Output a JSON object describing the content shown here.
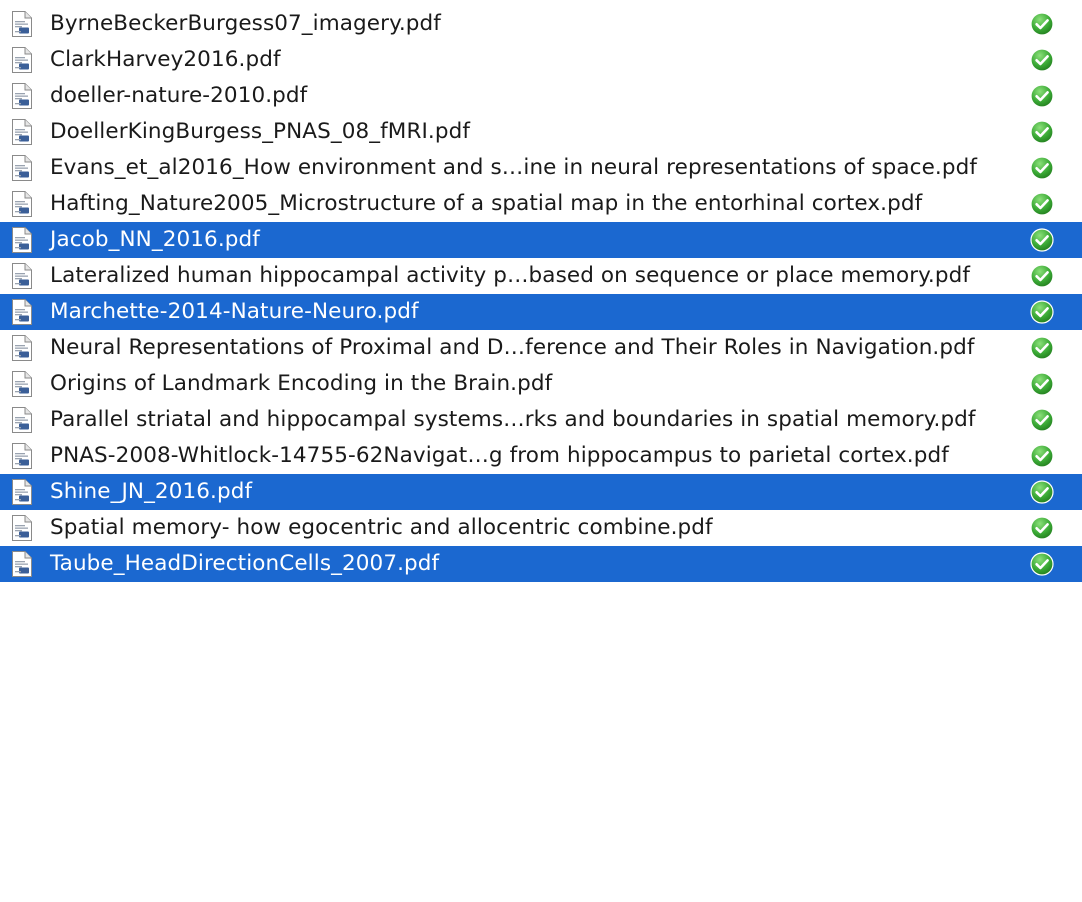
{
  "files": [
    {
      "name": "ByrneBeckerBurgess07_imagery.pdf",
      "selected": false,
      "icon": "pdf-document-icon",
      "status": "synced-checkmark-icon"
    },
    {
      "name": "ClarkHarvey2016.pdf",
      "selected": false,
      "icon": "pdf-document-icon",
      "status": "synced-checkmark-icon"
    },
    {
      "name": "doeller-nature-2010.pdf",
      "selected": false,
      "icon": "pdf-document-icon",
      "status": "synced-checkmark-icon"
    },
    {
      "name": "DoellerKingBurgess_PNAS_08_fMRI.pdf",
      "selected": false,
      "icon": "pdf-document-icon",
      "status": "synced-checkmark-icon"
    },
    {
      "name": "Evans_et_al2016_How environment and s…ine in neural representations of space.pdf",
      "selected": false,
      "icon": "pdf-document-icon",
      "status": "synced-checkmark-icon"
    },
    {
      "name": "Hafting_Nature2005_Microstructure of a spatial map in the entorhinal cortex.pdf",
      "selected": false,
      "icon": "pdf-document-icon",
      "status": "synced-checkmark-icon"
    },
    {
      "name": "Jacob_NN_2016.pdf",
      "selected": true,
      "icon": "pdf-document-icon",
      "status": "synced-checkmark-icon"
    },
    {
      "name": "Lateralized human hippocampal activity p…based on sequence or place memory.pdf",
      "selected": false,
      "icon": "pdf-document-icon",
      "status": "synced-checkmark-icon"
    },
    {
      "name": "Marchette-2014-Nature-Neuro.pdf",
      "selected": true,
      "icon": "pdf-document-icon",
      "status": "synced-checkmark-icon"
    },
    {
      "name": "Neural Representations of Proximal and D…ference and Their Roles in Navigation.pdf",
      "selected": false,
      "icon": "pdf-document-icon",
      "status": "synced-checkmark-icon"
    },
    {
      "name": "Origins of Landmark Encoding in the Brain.pdf",
      "selected": false,
      "icon": "pdf-document-icon",
      "status": "synced-checkmark-icon"
    },
    {
      "name": "Parallel striatal and hippocampal systems…rks and boundaries in spatial memory.pdf",
      "selected": false,
      "icon": "pdf-document-icon",
      "status": "synced-checkmark-icon"
    },
    {
      "name": "PNAS-2008-Whitlock-14755-62Navigat…g from hippocampus to parietal cortex.pdf",
      "selected": false,
      "icon": "pdf-document-icon",
      "status": "synced-checkmark-icon"
    },
    {
      "name": "Shine_JN_2016.pdf",
      "selected": true,
      "icon": "pdf-document-icon",
      "status": "synced-checkmark-icon"
    },
    {
      "name": "Spatial memory- how egocentric and allocentric combine.pdf",
      "selected": false,
      "icon": "pdf-document-icon",
      "status": "synced-checkmark-icon"
    },
    {
      "name": "Taube_HeadDirectionCells_2007.pdf",
      "selected": true,
      "icon": "pdf-document-icon",
      "status": "synced-checkmark-icon"
    }
  ],
  "colors": {
    "selection": "#1b68d0",
    "text": "#1a1a1a",
    "selected_text": "#ffffff",
    "status_green": "#3aa935"
  }
}
